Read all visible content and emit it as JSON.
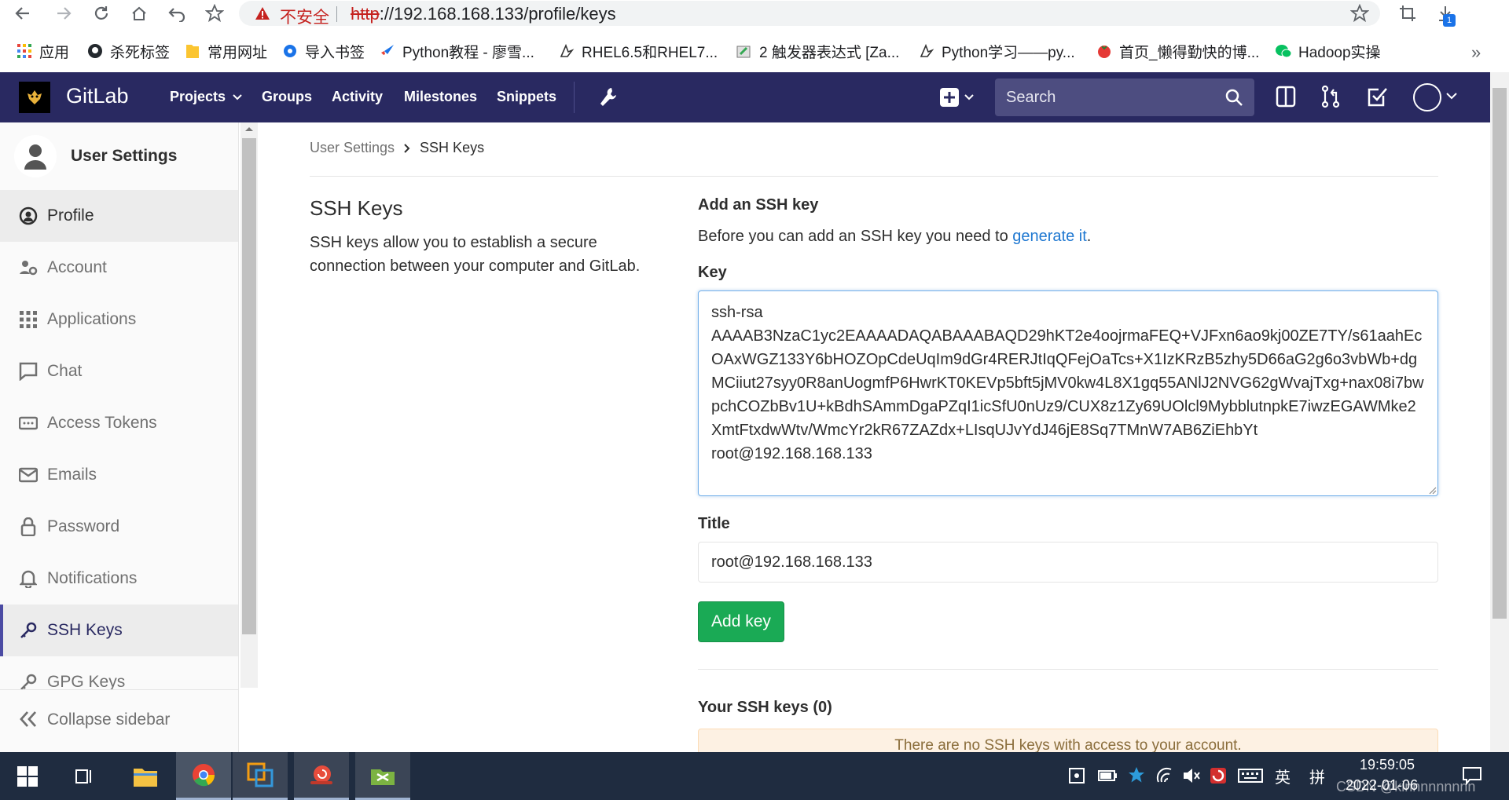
{
  "browser": {
    "security_label": "不安全",
    "url_scheme": "http",
    "url_rest": "://192.168.168.133/profile/keys",
    "download_count": "1",
    "bookmarks": [
      {
        "label": "应用",
        "icon": "apps-grid-icon"
      },
      {
        "label": "杀死标签",
        "icon": "github-icon"
      },
      {
        "label": "常用网址",
        "icon": "folder-icon"
      },
      {
        "label": "导入书签",
        "icon": "gear-icon"
      },
      {
        "label": "Python教程 - 廖雪...",
        "icon": "rocket-icon"
      },
      {
        "label": "RHEL6.5和RHEL7...",
        "icon": "bird-icon"
      },
      {
        "label": "2 触发器表达式 [Za...",
        "icon": "paint-icon"
      },
      {
        "label": "Python学习——py...",
        "icon": "bird-icon"
      },
      {
        "label": "首页_懒得勤快的博...",
        "icon": "tomato-icon"
      },
      {
        "label": "Hadoop实操",
        "icon": "wechat-icon"
      }
    ],
    "more": "»"
  },
  "navbar": {
    "brand": "GitLab",
    "items": [
      "Projects",
      "Groups",
      "Activity",
      "Milestones",
      "Snippets"
    ],
    "search_placeholder": "Search"
  },
  "sidebar": {
    "title": "User Settings",
    "items": [
      {
        "label": "Profile",
        "icon": "profile-icon"
      },
      {
        "label": "Account",
        "icon": "account-gear-icon"
      },
      {
        "label": "Applications",
        "icon": "applications-grid-icon"
      },
      {
        "label": "Chat",
        "icon": "chat-icon"
      },
      {
        "label": "Access Tokens",
        "icon": "token-icon"
      },
      {
        "label": "Emails",
        "icon": "email-icon"
      },
      {
        "label": "Password",
        "icon": "lock-icon"
      },
      {
        "label": "Notifications",
        "icon": "bell-icon"
      },
      {
        "label": "SSH Keys",
        "icon": "key-icon"
      },
      {
        "label": "GPG Keys",
        "icon": "key-icon"
      }
    ],
    "collapse_label": "Collapse sidebar"
  },
  "breadcrumb": {
    "parent": "User Settings",
    "separator": "›",
    "current": "SSH Keys"
  },
  "ssh": {
    "title": "SSH Keys",
    "description": "SSH keys allow you to establish a secure connection between your computer and GitLab.",
    "add_title": "Add an SSH key",
    "add_desc_prefix": "Before you can add an SSH key you need to ",
    "add_desc_link": "generate it",
    "add_desc_suffix": ".",
    "key_label": "Key",
    "key_value": "ssh-rsa\nAAAAB3NzaC1yc2EAAAADAQABAAABAQD29hKT2e4oojrmaFEQ+VJFxn6ao9kj00ZE7TY/s61aahEcOAxWGZ133Y6bHOZOpCdeUqIm9dGr4RERJtIqQFejOaTcs+X1IzKRzB5zhy5D66aG2g6o3vbWb+dgMCiiut27syy0R8anUogmfP6HwrKT0KEVp5bft5jMV0kw4L8X1gq55ANlJ2NVG62gWvajTxg+nax08i7bwpchCOZbBv1U+kBdhSAmmDgaPZqI1icSfU0nUz9/CUX8z1Zy69UOlcl9MybblutnpkE7iwzEGAWMke2XmtFtxdwWtv/WmcYr2kR67ZAZdx+LIsqUJvYdJ46jE8Sq7TMnW7AB6ZiEhbYt\nroot@192.168.168.133",
    "title_label": "Title",
    "title_value": "root@192.168.168.133",
    "add_button": "Add key",
    "your_keys": "Your SSH keys (0)",
    "no_keys": "There are no SSH keys with access to your account."
  },
  "taskbar": {
    "lang": "英",
    "ime": "拼",
    "time": "19:59:05",
    "date": "2022-01-06",
    "watermark": "CSDN @kinnnnnnnnn"
  },
  "colors": {
    "navbar": "#292961",
    "accent_green": "#1aaa55",
    "link": "#1f78d1",
    "warning_bg": "#fdf1e3"
  }
}
